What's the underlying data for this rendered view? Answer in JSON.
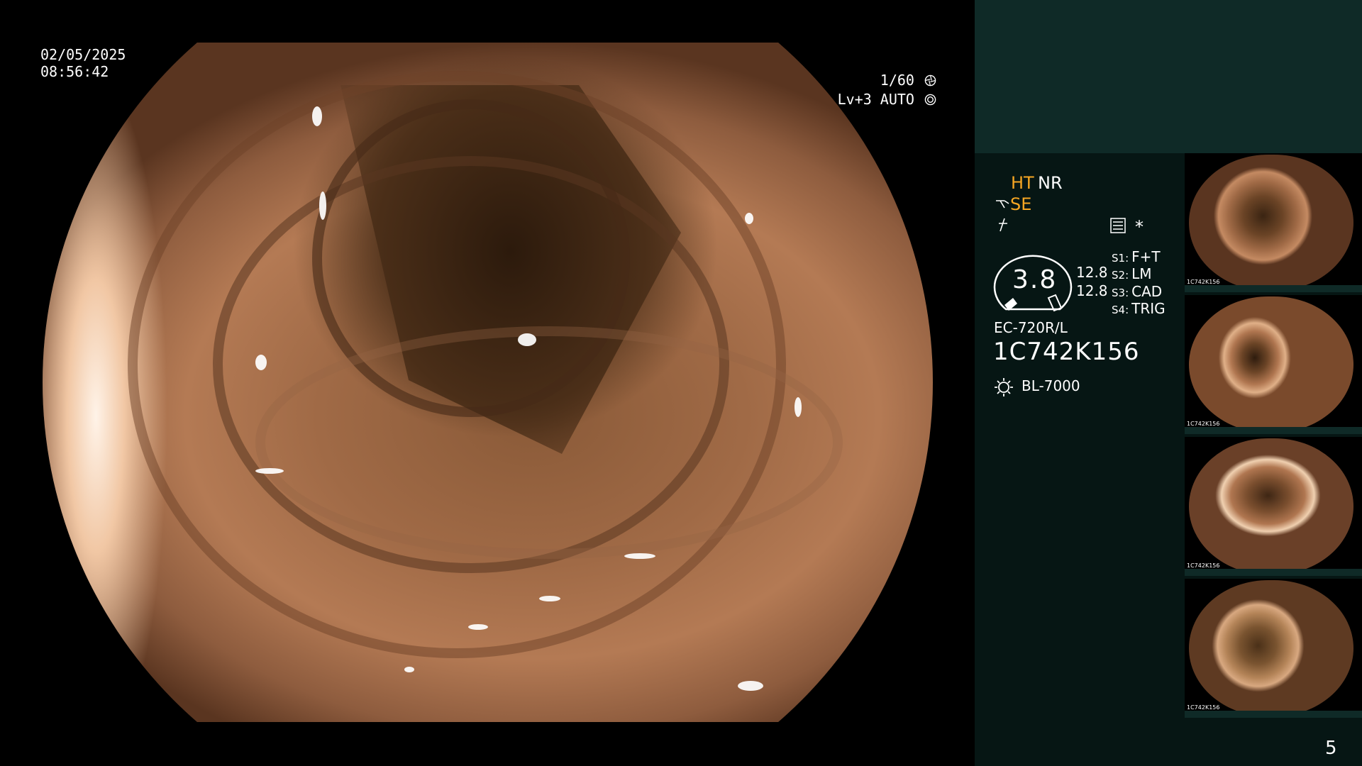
{
  "video": {
    "date": "02/05/2025",
    "time": "08:56:42",
    "shutter": "1/60",
    "level": "Lv+3 AUTO"
  },
  "panel": {
    "ht": "HT",
    "nr": "NR",
    "se": "SE",
    "star": "*",
    "gauge_value": "3.8",
    "value_1": "12.8",
    "value_2": "12.8",
    "switches": [
      {
        "key": "S1:",
        "value": "F+T"
      },
      {
        "key": "S2:",
        "value": "LM"
      },
      {
        "key": "S3:",
        "value": "CAD"
      },
      {
        "key": "S4:",
        "value": "TRIG"
      }
    ],
    "scope_model": "EC-720R/L",
    "scope_serial": "1C742K156",
    "light_source": "BL-7000",
    "thumbnail_id": "1C742K156",
    "page_number": "5"
  },
  "colors": {
    "panel_top": "#0f2a27",
    "panel_body": "#061614",
    "accent_orange": "#f6a623"
  },
  "icons": {
    "shutter": "aperture-icon",
    "level": "auto-iris-icon",
    "se": "structure-enhance-icon",
    "flash": "freeze-icon",
    "menu": "menu-icon",
    "light": "light-source-icon"
  }
}
